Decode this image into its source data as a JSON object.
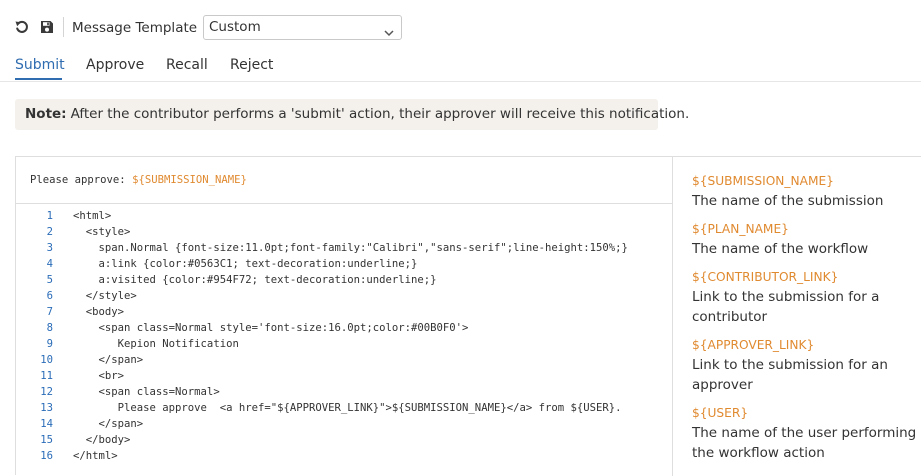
{
  "toolbar": {
    "undo_icon": "undo-icon",
    "save_icon": "save-icon",
    "template_label": "Message Template",
    "template_value": "Custom"
  },
  "tabs": [
    {
      "label": "Submit",
      "active": true
    },
    {
      "label": "Approve",
      "active": false
    },
    {
      "label": "Recall",
      "active": false
    },
    {
      "label": "Reject",
      "active": false
    }
  ],
  "note": {
    "bold": "Note:",
    "text": "After the contributor performs a 'submit' action, their approver will receive this notification."
  },
  "editor": {
    "subject_prefix": "Please approve: ",
    "subject_var": "${SUBMISSION_NAME}",
    "lines": [
      {
        "num": "1",
        "text": "<html>"
      },
      {
        "num": "2",
        "text": "  <style>"
      },
      {
        "num": "3",
        "text": "    span.Normal {font-size:11.0pt;font-family:\"Calibri\",\"sans-serif\";line-height:150%;}"
      },
      {
        "num": "4",
        "text": "    a:link {color:#0563C1; text-decoration:underline;}"
      },
      {
        "num": "5",
        "text": "    a:visited {color:#954F72; text-decoration:underline;}"
      },
      {
        "num": "6",
        "text": "  </style>"
      },
      {
        "num": "7",
        "text": "  <body>"
      },
      {
        "num": "8",
        "text": "    <span class=Normal style='font-size:16.0pt;color:#00B0F0'>"
      },
      {
        "num": "9",
        "text": "       Kepion Notification"
      },
      {
        "num": "10",
        "text": "    </span>"
      },
      {
        "num": "11",
        "text": "    <br>"
      },
      {
        "num": "12",
        "text": "    <span class=Normal>"
      },
      {
        "num": "13",
        "text": "       Please approve  <a href=\"${APPROVER_LINK}\">${SUBMISSION_NAME}</a> from ${USER}."
      },
      {
        "num": "14",
        "text": "    </span>"
      },
      {
        "num": "15",
        "text": "  </body>"
      },
      {
        "num": "16",
        "text": "</html>"
      }
    ]
  },
  "variables": [
    {
      "name": "${SUBMISSION_NAME}",
      "desc": "The name of the submission"
    },
    {
      "name": "${PLAN_NAME}",
      "desc": "The name of the workflow"
    },
    {
      "name": "${CONTRIBUTOR_LINK}",
      "desc": "Link to the submission for a contributor"
    },
    {
      "name": "${APPROVER_LINK}",
      "desc": "Link to the submission for an approver"
    },
    {
      "name": "${USER}",
      "desc": "The name of the user performing the workflow action"
    }
  ],
  "colors": {
    "accent": "#2f6cb0",
    "variable": "#e08a30",
    "line_number": "#2a6cb8",
    "note_bg": "#f4f1ec"
  }
}
